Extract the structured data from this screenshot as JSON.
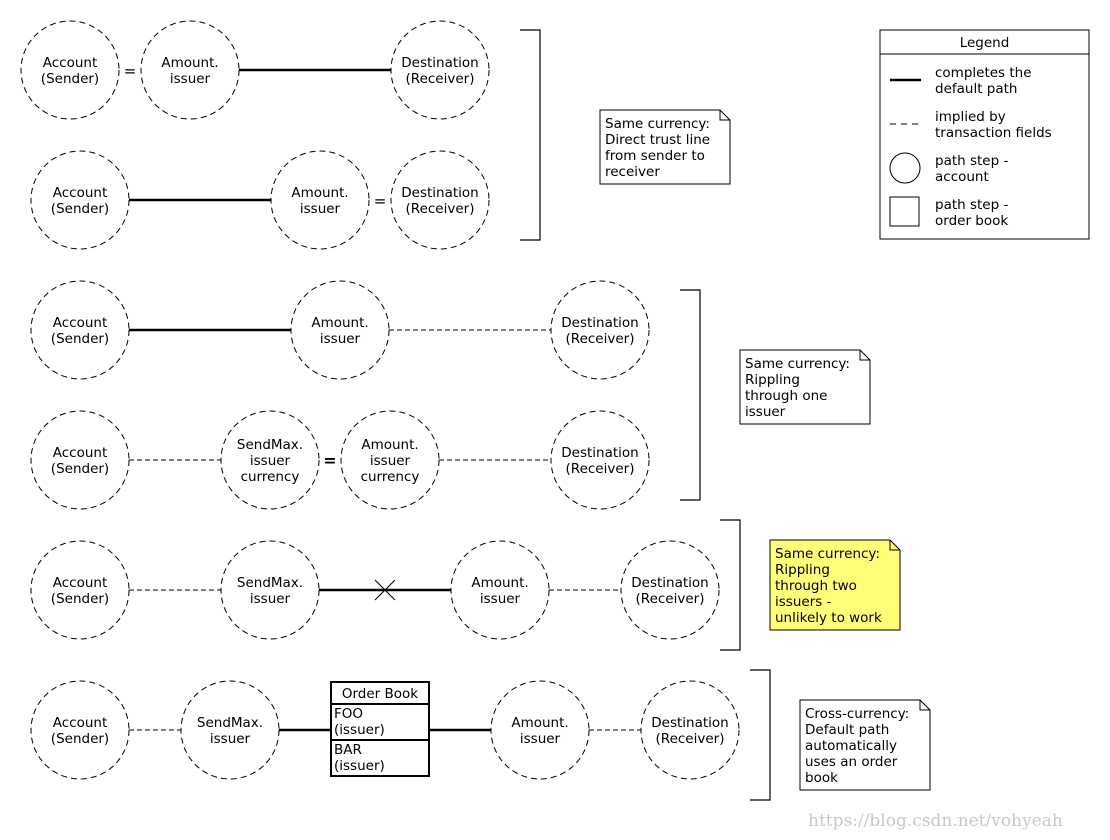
{
  "legend": {
    "title": "Legend",
    "items": [
      {
        "symbol": "solid-line",
        "label": [
          "completes the",
          "default path"
        ]
      },
      {
        "symbol": "dashed-line",
        "label": [
          "implied by",
          "transaction fields"
        ]
      },
      {
        "symbol": "circle",
        "label": [
          "path step -",
          "account"
        ]
      },
      {
        "symbol": "square",
        "label": [
          "path step -",
          "order book"
        ]
      }
    ]
  },
  "groups": [
    {
      "note": {
        "lines": [
          "Same currency:",
          "Direct trust line",
          "from sender to",
          "receiver"
        ],
        "highlight": false
      },
      "rows": [
        {
          "nodes": [
            {
              "type": "account",
              "lines": [
                "Account",
                "(Sender)"
              ]
            },
            {
              "type": "account",
              "lines": [
                "Amount.",
                "issuer"
              ]
            },
            {
              "type": "account",
              "lines": [
                "Destination",
                "(Receiver)"
              ]
            }
          ],
          "links": [
            "equals",
            "solid"
          ]
        },
        {
          "nodes": [
            {
              "type": "account",
              "lines": [
                "Account",
                "(Sender)"
              ]
            },
            {
              "type": "account",
              "lines": [
                "Amount.",
                "issuer"
              ]
            },
            {
              "type": "account",
              "lines": [
                "Destination",
                "(Receiver)"
              ]
            }
          ],
          "links": [
            "solid",
            "equals"
          ]
        }
      ]
    },
    {
      "note": {
        "lines": [
          "Same currency:",
          "Rippling",
          "through one",
          "issuer"
        ],
        "highlight": false
      },
      "rows": [
        {
          "nodes": [
            {
              "type": "account",
              "lines": [
                "Account",
                "(Sender)"
              ]
            },
            {
              "type": "account",
              "lines": [
                "Amount.",
                "issuer"
              ]
            },
            {
              "type": "account",
              "lines": [
                "Destination",
                "(Receiver)"
              ]
            }
          ],
          "links": [
            "solid",
            "dashed"
          ]
        },
        {
          "nodes": [
            {
              "type": "account",
              "lines": [
                "Account",
                "(Sender)"
              ]
            },
            {
              "type": "account",
              "lines": [
                "SendMax.",
                "issuer",
                "currency"
              ]
            },
            {
              "type": "account",
              "lines": [
                "Amount.",
                "issuer",
                "currency"
              ]
            },
            {
              "type": "account",
              "lines": [
                "Destination",
                "(Receiver)"
              ]
            }
          ],
          "links": [
            "dashed",
            "equals-bold",
            "dashed"
          ]
        }
      ]
    },
    {
      "note": {
        "lines": [
          "Same currency:",
          "Rippling",
          "through two",
          "issuers -",
          "unlikely to work"
        ],
        "highlight": true
      },
      "rows": [
        {
          "nodes": [
            {
              "type": "account",
              "lines": [
                "Account",
                "(Sender)"
              ]
            },
            {
              "type": "account",
              "lines": [
                "SendMax.",
                "issuer"
              ]
            },
            {
              "type": "account",
              "lines": [
                "Amount.",
                "issuer"
              ]
            },
            {
              "type": "account",
              "lines": [
                "Destination",
                "(Receiver)"
              ]
            }
          ],
          "links": [
            "dashed",
            "solid-crossed",
            "dashed"
          ]
        }
      ]
    },
    {
      "note": {
        "lines": [
          "Cross-currency:",
          "Default path",
          "automatically",
          "uses an order",
          "book"
        ],
        "highlight": false
      },
      "rows": [
        {
          "nodes": [
            {
              "type": "account",
              "lines": [
                "Account",
                "(Sender)"
              ]
            },
            {
              "type": "account",
              "lines": [
                "SendMax.",
                "issuer"
              ]
            },
            {
              "type": "orderbook",
              "title": "Order Book",
              "entries": [
                [
                  "FOO",
                  "(issuer)"
                ],
                [
                  "BAR",
                  "(issuer)"
                ]
              ]
            },
            {
              "type": "account",
              "lines": [
                "Amount.",
                "issuer"
              ]
            },
            {
              "type": "account",
              "lines": [
                "Destination",
                "(Receiver)"
              ]
            }
          ],
          "links": [
            "dashed",
            "solid",
            "solid",
            "dashed"
          ]
        }
      ]
    }
  ],
  "colors": {
    "stroke": "#000000",
    "note_fill": "#ffffff",
    "note_highlight_fill": "#ffff77",
    "watermark": "#c8c8c8"
  },
  "watermark": "https://blog.csdn.net/vohyeah"
}
